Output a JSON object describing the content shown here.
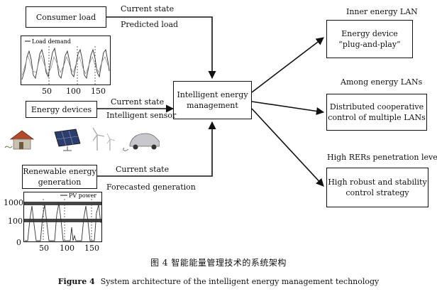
{
  "boxes": {
    "consumer_load": "Consumer load",
    "energy_devices": "Energy devices",
    "renewable_line1": "Renewable energy",
    "renewable_line2": "generation",
    "iem_line1": "Intelligent energy",
    "iem_line2": "management",
    "device_line1": "Energy device",
    "device_line2": "“plug-and-play”",
    "distributed_line1": "Distributed cooperative",
    "distributed_line2": "control of multiple LANs",
    "robust_line1": "High robust and stability",
    "robust_line2": "control strategy"
  },
  "labels": {
    "current_state_top": "Current state",
    "predicted_load": "Predicted load",
    "current_state_mid": "Current state",
    "intelligent_sensor": "Intelligent sensor",
    "current_state_bottom": "Current state",
    "forecasted_generation": "Forecasted generation",
    "inner_lan": "Inner energy LAN",
    "among_lans": "Among energy LANs",
    "high_rers": "High RERs penetration level"
  },
  "load_plot": {
    "legend": "Load demand",
    "ticks": [
      "50",
      "100",
      "150"
    ]
  },
  "pv_plot": {
    "legend": "PV power",
    "xticks": [
      "50",
      "100",
      "150"
    ],
    "yticks": [
      "1000",
      "100",
      "0"
    ]
  },
  "caption": {
    "cn": "图 4   智能能量管理技术的系统架构",
    "en_prefix": "Figure 4",
    "en_text": "System architecture of the intelligent energy management technology"
  }
}
